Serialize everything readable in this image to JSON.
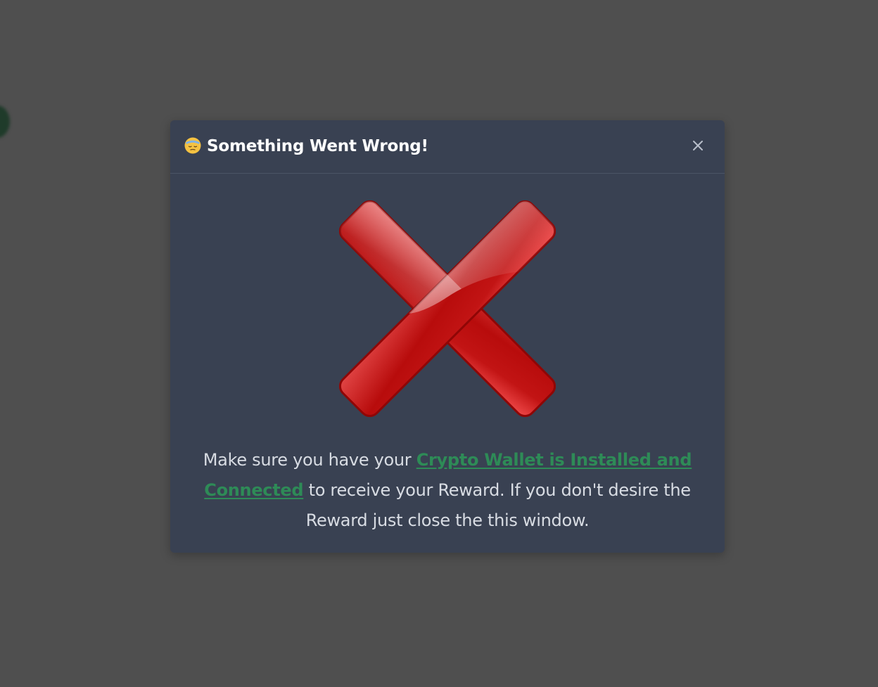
{
  "dialog": {
    "title_icon": "face-with-bandage-emoji",
    "title": "Something Went Wrong!",
    "close_icon": "close-icon",
    "graphic_icon": "red-x-error-icon",
    "message": {
      "before_link": "Make sure you have your ",
      "link_text": "Crypto Wallet is Installed and Connected",
      "after_link": " to receive your Reward. If you don't desire the Reward just close the this window."
    }
  },
  "colors": {
    "backdrop": "#4f4f4f",
    "dialog_background": "#394152",
    "title_text": "#ffffff",
    "body_text": "#d8dce3",
    "link": "#2e8b57",
    "error_red": "#d41515"
  }
}
